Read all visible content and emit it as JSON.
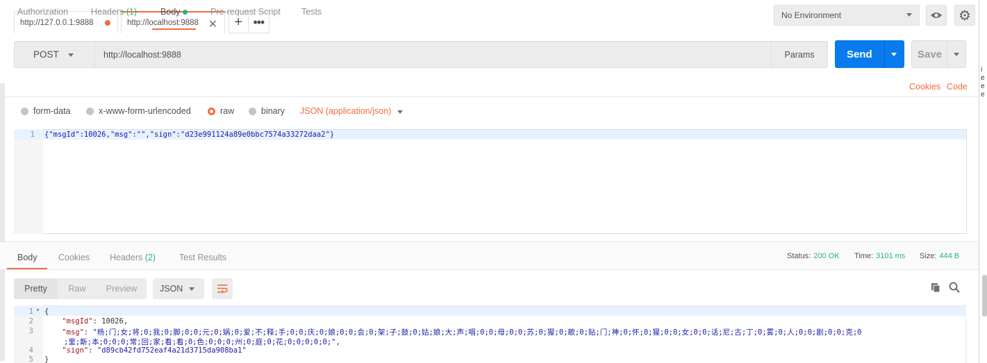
{
  "tabs": [
    {
      "label": "http://127.0.0.1:9888",
      "modified": true
    },
    {
      "label": "http://localhost:9888",
      "active": true
    }
  ],
  "environment": {
    "selected": "No Environment"
  },
  "request": {
    "method": "POST",
    "url": "http://localhost:9888",
    "params_label": "Params",
    "send_label": "Send",
    "save_label": "Save"
  },
  "request_tabs": {
    "authorization": "Authorization",
    "headers": "Headers",
    "headers_count": "(1)",
    "body": "Body",
    "prerequest": "Pre-request Script",
    "tests": "Tests",
    "cookies_link": "Cookies",
    "code_link": "Code"
  },
  "body_options": {
    "form_data": "form-data",
    "urlencoded": "x-www-form-urlencoded",
    "raw": "raw",
    "binary": "binary",
    "content_type": "JSON (application/json)",
    "selected": "raw"
  },
  "request_body": {
    "line_number": "1",
    "code": "{\"msgId\":10026,\"msg\":\"\",\"sign\":\"d23e991124a89e0bbc7574a33272daa2\"}"
  },
  "response_tabs": {
    "body": "Body",
    "cookies": "Cookies",
    "headers": "Headers",
    "headers_count": "(2)",
    "test_results": "Test Results"
  },
  "response_status": {
    "status_label": "Status:",
    "status_value": "200 OK",
    "time_label": "Time:",
    "time_value": "3101 ms",
    "size_label": "Size:",
    "size_value": "444 B"
  },
  "response_format": {
    "pretty": "Pretty",
    "raw": "Raw",
    "preview": "Preview",
    "language": "JSON"
  },
  "response_body": {
    "lines": [
      {
        "n": "1",
        "text": "{"
      },
      {
        "n": "2",
        "key": "\"msgId\"",
        "sep": ": ",
        "value": "10026",
        "tail": ","
      },
      {
        "n": "3",
        "key": "\"msg\"",
        "sep": ": ",
        "value": "\"杨;门;女;将;0;我;0;脚;0;0;元;0;娲;0;爱;不;释;手;0;0;庆;0;娘;0;0;会;0;架;子;鼓;0;姑;娘;大;声;唱;0;0;母;0;0;苏;0;猩;0;歌;0;贴;门;神;0;怀;0;猩;0;0;女;0;0;话;尼;古;丁;0;雾;0;人;0;0;剧;0;0;克;0",
        "cont": ";里;斯;本;0;0;0;常;回;家;看;看;0;色;0;0;0;州;0;庭;0;花;0;0;0;0;0;\"",
        "tail": ","
      },
      {
        "n": "4",
        "key": "\"sign\"",
        "sep": ": ",
        "value": "\"d89cb42fd752eaf4a21d3715da908ba1\"",
        "tail": ""
      },
      {
        "n": "5",
        "text": "}"
      }
    ]
  },
  "colors": {
    "accent": "#f26b3a",
    "send": "#097bed",
    "status_ok": "#26b47f"
  },
  "icons": [
    "eye-icon",
    "gear-icon",
    "close-icon",
    "plus-icon",
    "more-icon",
    "wrap-icon",
    "copy-icon",
    "search-icon",
    "chevron-down-icon"
  ]
}
